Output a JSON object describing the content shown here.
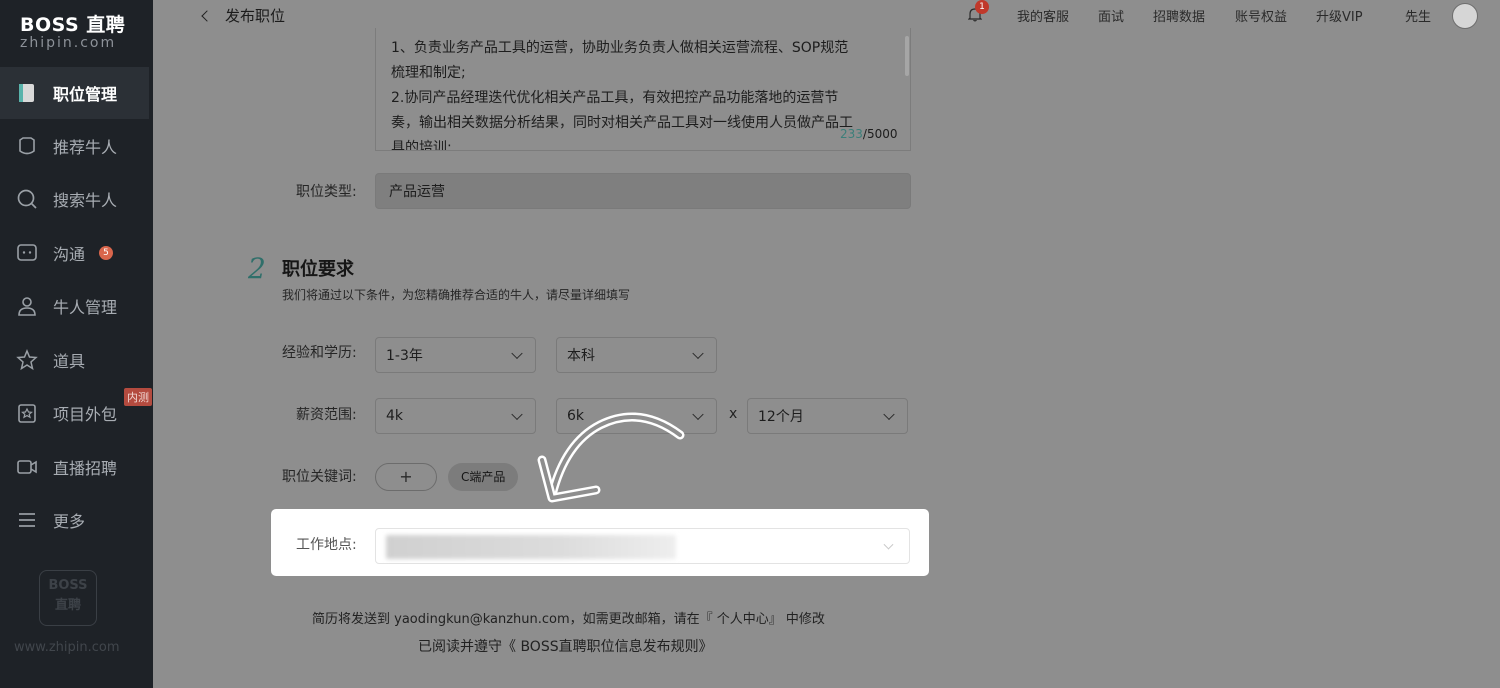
{
  "sidebar": {
    "logo_main": "BOSS 直聘",
    "logo_sub": "zhipin.com",
    "items": [
      {
        "label": "职位管理",
        "icon": "job-manage-icon"
      },
      {
        "label": "推荐牛人",
        "icon": "recommend-icon"
      },
      {
        "label": "搜索牛人",
        "icon": "search-icon"
      },
      {
        "label": "沟通",
        "icon": "chat-icon",
        "badge": "5"
      },
      {
        "label": "牛人管理",
        "icon": "person-icon"
      },
      {
        "label": "道具",
        "icon": "tools-icon"
      },
      {
        "label": "项目外包",
        "icon": "project-icon",
        "tag": "内测"
      },
      {
        "label": "直播招聘",
        "icon": "live-icon"
      },
      {
        "label": "更多",
        "icon": "menu-icon"
      }
    ],
    "bottom_logo_line1": "BOSS",
    "bottom_logo_line2": "直聘",
    "site_url": "www.zhipin.com"
  },
  "topbar": {
    "back_label": "发布职位",
    "notification_count": "1",
    "links": [
      "我的客服",
      "面试",
      "招聘数据",
      "账号权益",
      "升级VIP"
    ],
    "user_name": "先生"
  },
  "description": {
    "lines": [
      "1、负责业务产品工具的运营，协助业务负责人做相关运营流程、SOP规范",
      "梳理和制定;",
      "2.协同产品经理迭代优化相关产品工具，有效把控产品功能落地的运营节",
      "奏，输出相关数据分析结果，同时对相关产品工具对一线使用人员做产品工",
      "具的培训;"
    ],
    "count_current": "233",
    "count_max": "/5000"
  },
  "job_type": {
    "label": "职位类型:",
    "value": "产品运营"
  },
  "section2": {
    "number": "2",
    "title": "职位要求",
    "subtitle": "我们将通过以下条件，为您精确推荐合适的牛人，请尽量详细填写"
  },
  "experience": {
    "label": "经验和学历:",
    "experience_value": "1-3年",
    "education_value": "本科"
  },
  "salary": {
    "label": "薪资范围:",
    "min": "4k",
    "max": "6k",
    "times": "x",
    "months": "12个月"
  },
  "keywords": {
    "label": "职位关键词:",
    "add": "+",
    "chips": [
      "C端产品"
    ]
  },
  "location": {
    "label": "工作地点:"
  },
  "footer": {
    "email_notice": "简历将发送到 yaodingkun@kanzhun.com，如需更改邮箱，请在『 个人中心』 中修改",
    "rules": "已阅读并遵守《 BOSS直聘职位信息发布规则》"
  }
}
